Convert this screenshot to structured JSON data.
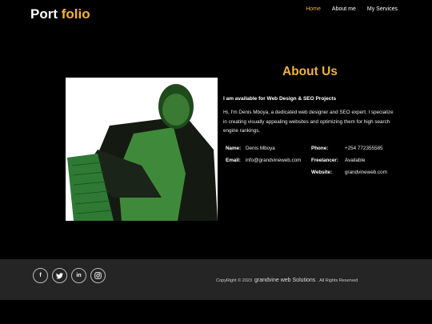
{
  "logo": {
    "part1": "Port",
    "part2": "folio"
  },
  "nav": [
    {
      "label": "Home",
      "active": true
    },
    {
      "label": "About me",
      "active": false
    },
    {
      "label": "My Services",
      "active": false
    }
  ],
  "about": {
    "title": "About Us",
    "tagline": "I am available for Web Design & SEO Projects",
    "bio": "Hi, I'm Denis Mboya, a dedicated web designer and SEO expert. I specialize in creating visually appealing websites and optimizing them for high search engine rankings.",
    "details": {
      "name_label": "Name:",
      "name_value": "Denis Mboya",
      "email_label": "Email:",
      "email_value": "info@grandvineweb.com",
      "phone_label": "Phone:",
      "phone_value": "+254 772355585",
      "freelancer_label": "Freelancer:",
      "freelancer_value": "Available",
      "website_label": "Website:",
      "website_value": "grandvineweb.com"
    }
  },
  "footer": {
    "socials": [
      {
        "icon": "facebook-icon",
        "glyph": "f"
      },
      {
        "icon": "twitter-icon",
        "glyph": "t"
      },
      {
        "icon": "linkedin-icon",
        "glyph": "in"
      },
      {
        "icon": "instagram-icon",
        "glyph": "◎"
      }
    ],
    "copyright_prefix": "CopyRight © 2023",
    "brand": "grandvine web Solutions",
    "rights": ". All Rights Reserved"
  }
}
